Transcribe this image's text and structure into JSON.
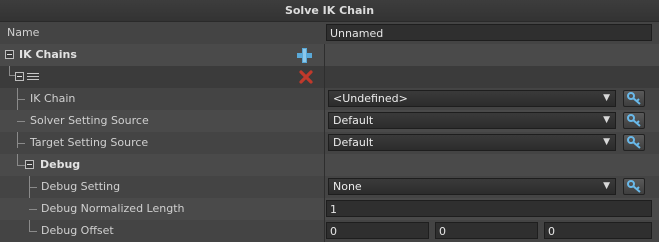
{
  "title": "Solve IK Chain",
  "name_row": {
    "label": "Name",
    "value": "Unnamed"
  },
  "ik_chains": {
    "label": "IK Chains",
    "add_icon": "plus-icon",
    "remove_icon": "red-x-icon",
    "item_icon": "list-icon"
  },
  "rows": {
    "ik_chain": {
      "label": "IK Chain",
      "value": "<Undefined>"
    },
    "solver": {
      "label": "Solver Setting Source",
      "value": "Default"
    },
    "target": {
      "label": "Target Setting Source",
      "value": "Default"
    }
  },
  "debug": {
    "label": "Debug",
    "setting": {
      "label": "Debug Setting",
      "value": "None"
    },
    "normalized_length": {
      "label": "Debug Normalized Length",
      "value": "1"
    },
    "offset": {
      "label": "Debug Offset",
      "x": "0",
      "y": "0",
      "z": "0"
    }
  },
  "colors": {
    "accent_blue": "#5aa9d8",
    "remove_red": "#c0392b",
    "background": "#444444"
  }
}
